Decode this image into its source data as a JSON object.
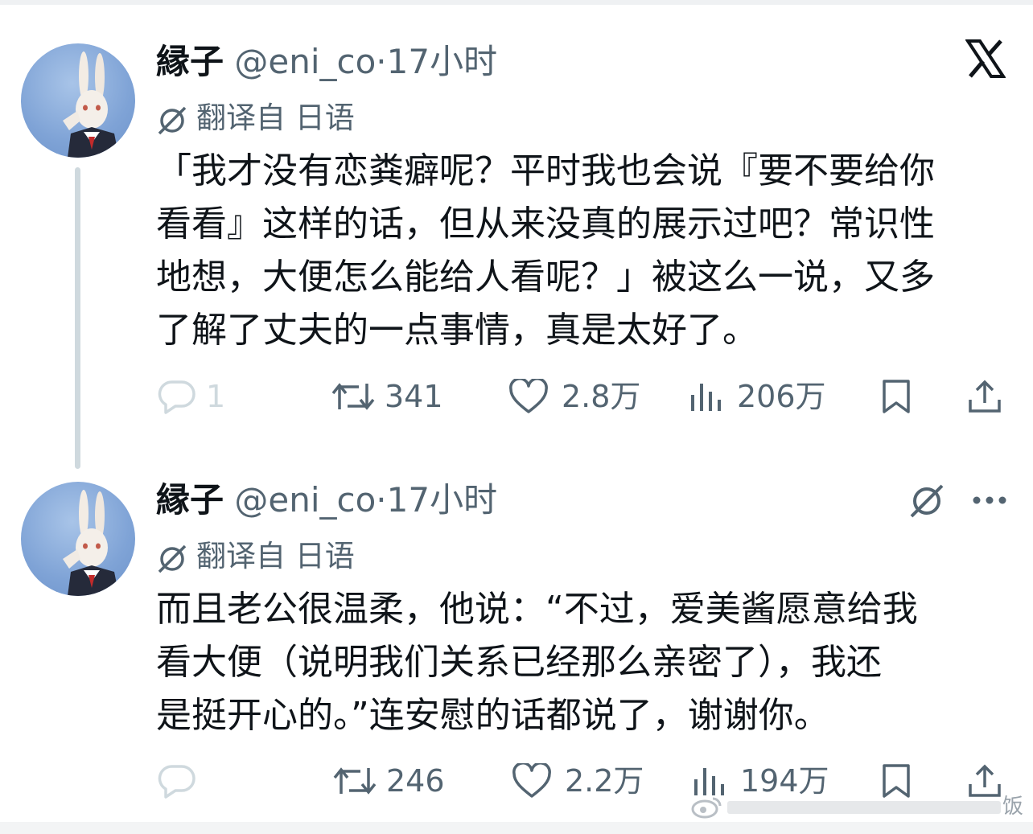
{
  "tweets": [
    {
      "author_name": "縁子",
      "handle": "@eni_co",
      "separator": "·",
      "time": "17小时",
      "translated_label": "翻译自 日语",
      "body_lines": [
        "「我才没有恋粪癖呢？平时我也会说『要不要给你",
        "看看』这样的话，但从来没真的展示过吧？常识性",
        "地想，大便怎么能给人看呢？」被这么一说，又多",
        "了解了丈夫的一点事情，真是太好了。"
      ],
      "stats": {
        "replies": "1",
        "reposts": "341",
        "likes": "2.8万",
        "views": "206万"
      }
    },
    {
      "author_name": "縁子",
      "handle": "@eni_co",
      "separator": "·",
      "time": "17小时",
      "translated_label": "翻译自 日语",
      "body_lines": [
        "而且老公很温柔，他说：“不过，爱美酱愿意给我",
        "看大便（说明我们关系已经那么亲密了），我还",
        "是挺开心的。”连安慰的话都说了，谢谢你。"
      ],
      "stats": {
        "replies": "",
        "reposts": "246",
        "likes": "2.2万",
        "views": "194万"
      }
    }
  ],
  "icons": [
    "x-logo-icon",
    "grok-icon",
    "more-icon",
    "translate-icon",
    "reply-icon",
    "repost-icon",
    "like-icon",
    "views-icon",
    "bookmark-icon",
    "share-icon"
  ],
  "watermark": {
    "text": "饭"
  },
  "colors": {
    "text": "#0f1419",
    "secondary": "#536471",
    "thread_line": "#cfd9de",
    "avatar_bg": "#7fa3d6"
  }
}
